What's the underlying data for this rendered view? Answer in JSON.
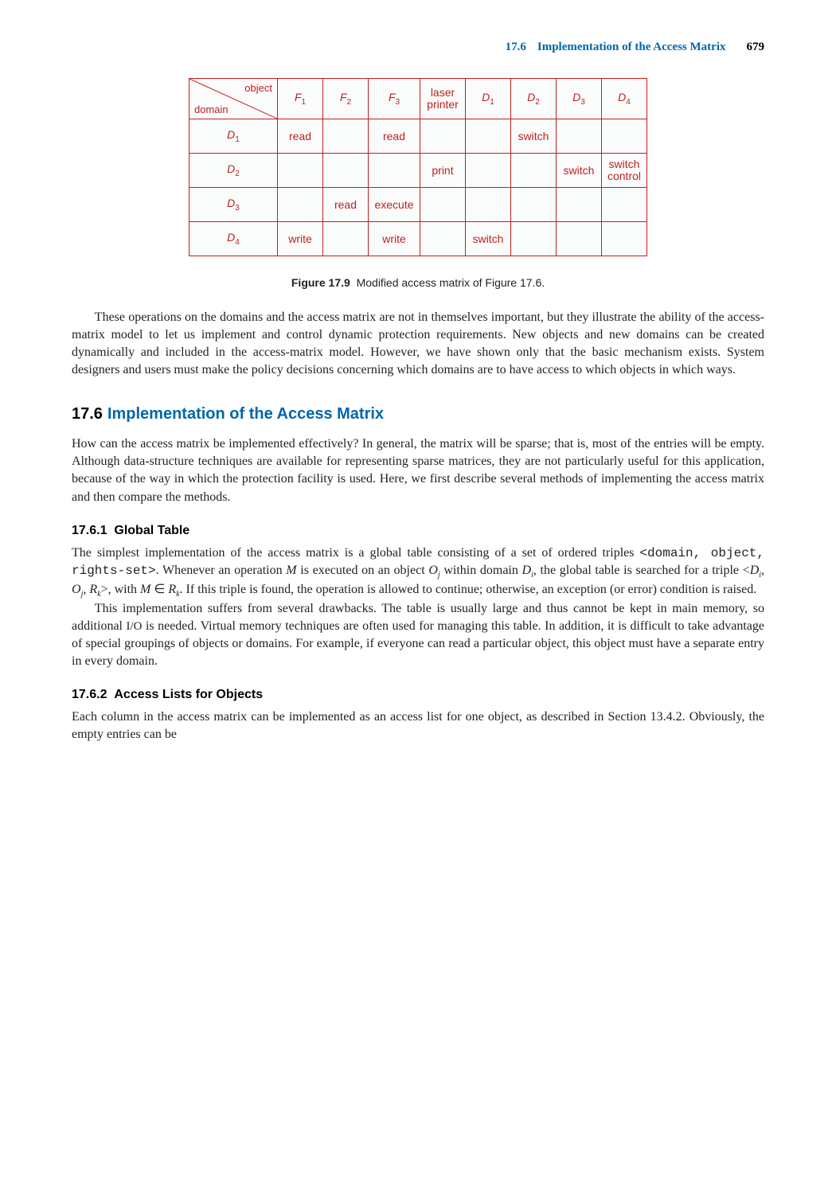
{
  "header": {
    "section_num": "17.6",
    "section_title": "Implementation of the Access Matrix",
    "page": "679"
  },
  "matrix": {
    "diag_top": "object",
    "diag_bottom": "domain",
    "cols": [
      "F",
      "F",
      "F",
      "laser printer",
      "D",
      "D",
      "D",
      "D"
    ],
    "col_subs": [
      "1",
      "2",
      "3",
      "",
      "1",
      "2",
      "3",
      "4"
    ],
    "rows": [
      "D",
      "D",
      "D",
      "D"
    ],
    "row_subs": [
      "1",
      "2",
      "3",
      "4"
    ],
    "cells": [
      [
        "read",
        "",
        "read",
        "",
        "",
        "switch",
        "",
        ""
      ],
      [
        "",
        "",
        "",
        "print",
        "",
        "",
        "switch",
        "switch control"
      ],
      [
        "",
        "read",
        "execute",
        "",
        "",
        "",
        "",
        ""
      ],
      [
        "write",
        "",
        "write",
        "",
        "switch",
        "",
        "",
        ""
      ]
    ]
  },
  "figure": {
    "label": "Figure 17.9",
    "caption": "Modified access matrix of Figure 17.6."
  },
  "para1": "These operations on the domains and the access matrix are not in themselves important, but they illustrate the ability of the access-matrix model to let us implement and control dynamic protection requirements. New objects and new domains can be created dynamically and included in the access-matrix model. However, we have shown only that the basic mechanism exists. System designers and users must make the policy decisions concerning which domains are to have access to which objects in which ways.",
  "section": {
    "num": "17.6",
    "title": "Implementation of the Access Matrix"
  },
  "para2": "How can the access matrix be implemented effectively? In general, the matrix will be sparse; that is, most of the entries will be empty. Although data-structure techniques are available for representing sparse matrices, they are not particularly useful for this application, because of the way in which the protection facility is used. Here, we first describe several methods of implementing the access matrix and then compare the methods.",
  "sub1": {
    "num": "17.6.1",
    "title": "Global Table"
  },
  "para3a": "The simplest implementation of the access matrix is a global table consisting of a set of ordered triples ",
  "para3b": "<domain, object, rights-set>",
  "para3c": ". Whenever an operation ",
  "para3c_M": "M",
  "para3d": " is executed on an object ",
  "para3d_O": "O",
  "para3d_j": "j",
  "para3e": " within domain ",
  "para3e_D": "D",
  "para3e_i": "i",
  "para3f": ", the global table is searched for a triple <",
  "para3f_Di": "D",
  "para3f_i": "i",
  "para3g": ", ",
  "para3g_Oj": "O",
  "para3g_j": "j",
  "para3h": ", ",
  "para3h_Rk": "R",
  "para3h_k": "k",
  "para3i": ">, with ",
  "para3i_M": "M",
  "para3i_in": " ∈ ",
  "para3i_Rk": "R",
  "para3i_k": "k",
  "para3j": ". If this triple is found, the operation is allowed to continue; otherwise, an exception (or error) condition is raised.",
  "para4a": "This implementation suffers from several drawbacks. The table is usually large and thus cannot be kept in main memory, so additional ",
  "para4b": "I/O",
  "para4c": " is needed. Virtual memory techniques are often used for managing this table. In addition, it is difficult to take advantage of special groupings of objects or domains. For example, if everyone can read a particular object, this object must have a separate entry in every domain.",
  "sub2": {
    "num": "17.6.2",
    "title": "Access Lists for Objects"
  },
  "para5": "Each column in the access matrix can be implemented as an access list for one object, as described in Section 13.4.2. Obviously, the empty entries can be"
}
